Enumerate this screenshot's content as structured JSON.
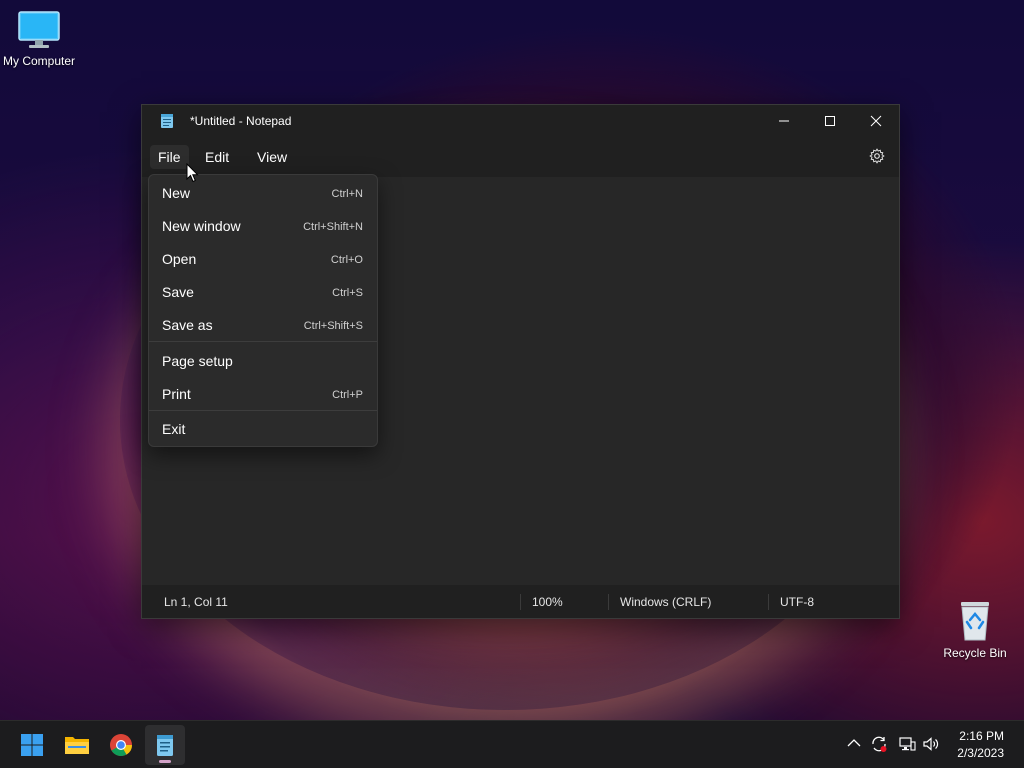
{
  "desktop": {
    "icons": [
      {
        "label": "My Computer"
      },
      {
        "label": "Recycle Bin"
      }
    ]
  },
  "window": {
    "title": "*Untitled - Notepad",
    "menu": {
      "file": "File",
      "edit": "Edit",
      "view": "View"
    },
    "status": {
      "position": "Ln 1, Col 11",
      "zoom": "100%",
      "line_ending": "Windows (CRLF)",
      "encoding": "UTF-8"
    }
  },
  "file_menu": {
    "items": [
      {
        "label": "New",
        "shortcut": "Ctrl+N"
      },
      {
        "label": "New window",
        "shortcut": "Ctrl+Shift+N"
      },
      {
        "label": "Open",
        "shortcut": "Ctrl+O"
      },
      {
        "label": "Save",
        "shortcut": "Ctrl+S"
      },
      {
        "label": "Save as",
        "shortcut": "Ctrl+Shift+S"
      },
      {
        "label": "Page setup",
        "shortcut": ""
      },
      {
        "label": "Print",
        "shortcut": "Ctrl+P"
      },
      {
        "label": "Exit",
        "shortcut": ""
      }
    ]
  },
  "taskbar": {
    "apps": [
      "start-icon",
      "file-explorer-icon",
      "chrome-icon",
      "notepad-icon"
    ],
    "clock": {
      "time": "2:16 PM",
      "date": "2/3/2023"
    }
  },
  "colors": {
    "window_bg": "#272727",
    "titlebar_bg": "#202020",
    "menu_bg": "#2b2b2b",
    "taskbar_bg": "#1c1c1e",
    "start_blue": "#3aa0f0"
  }
}
